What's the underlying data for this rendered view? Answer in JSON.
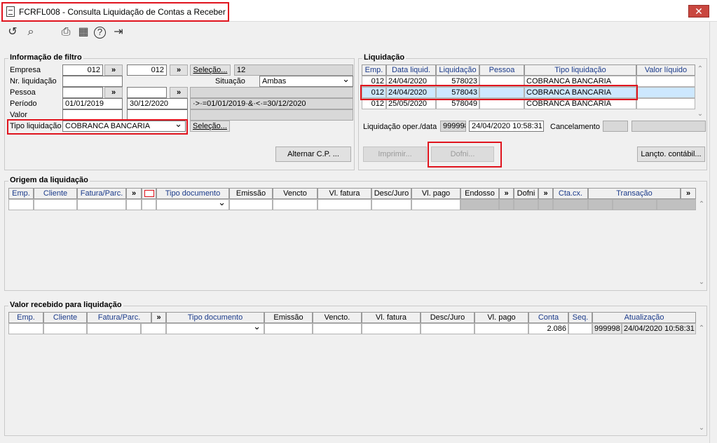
{
  "window": {
    "title": "FCRFL008 - Consulta Liquidação de Contas a Receber",
    "close_glyph": "✕"
  },
  "toolbar": [
    {
      "name": "undo-icon",
      "glyph": "↺"
    },
    {
      "name": "search-icon",
      "glyph": "⌕"
    },
    {
      "name": "print-icon",
      "glyph": "⎙"
    },
    {
      "name": "calendar-icon",
      "glyph": "▦"
    },
    {
      "name": "help-icon",
      "glyph": "?"
    },
    {
      "name": "exit-icon",
      "glyph": "⇥"
    }
  ],
  "filter": {
    "legend": "Informação de filtro",
    "empresa": {
      "label": "Empresa",
      "from": "012",
      "to": "012",
      "selecao": "Seleção...",
      "display": "12"
    },
    "nr_liquidacao": {
      "label": "Nr. liquidação"
    },
    "situacao": {
      "label": "Situação",
      "value": "Ambas"
    },
    "pessoa": {
      "label": "Pessoa"
    },
    "periodo": {
      "label": "Período",
      "from": "01/01/2019",
      "to": "30/12/2020",
      "expr": "·>·=01/01/2019·&·<·=30/12/2020"
    },
    "valor": {
      "label": "Valor"
    },
    "tipo_liquidacao": {
      "label": "Tipo liquidação",
      "value": "COBRANCA BANCARIA",
      "selecao": "Seleção..."
    },
    "range_btn": "»",
    "alternar_cp": "Alternar C.P. ..."
  },
  "liquidacao": {
    "legend": "Liquidação",
    "headers": [
      "Emp.",
      "Data liquid.",
      "Liquidação",
      "Pessoa",
      "Tipo liquidação",
      "Valor líquido"
    ],
    "rows": [
      [
        "012",
        "24/04/2020",
        "578023",
        "",
        "COBRANCA BANCARIA",
        ""
      ],
      [
        "012",
        "24/04/2020",
        "578043",
        "",
        "COBRANCA BANCARIA",
        ""
      ],
      [
        "012",
        "25/05/2020",
        "578049",
        "",
        "COBRANCA BANCARIA",
        ""
      ]
    ],
    "oper_label": "Liquidação oper./data",
    "oper_value": "999998",
    "oper_date": "24/04/2020 10:58:31",
    "cancel_label": "Cancelamento",
    "imprimir": "Imprimir...",
    "dofni": "Dofni...",
    "lancto": "Lançto. contábil..."
  },
  "origem": {
    "legend": "Origem da liquidação",
    "headers": [
      "Emp.",
      "Cliente",
      "Fatura/Parc.",
      "»",
      "",
      "Tipo documento",
      "Emissão",
      "Vencto",
      "Vl. fatura",
      "Desc/Juro",
      "Vl. pago",
      "Endosso",
      "»",
      "Dofni",
      "»",
      "Cta.cx.",
      "Transação",
      "»"
    ]
  },
  "valor_recebido": {
    "legend": "Valor recebido para liquidação",
    "headers": [
      "Emp.",
      "Cliente",
      "Fatura/Parc.",
      "»",
      "Tipo documento",
      "Emissão",
      "Vencto.",
      "Vl. fatura",
      "Desc/Juro",
      "Vl. pago",
      "Conta",
      "Seq.",
      "Atualização"
    ],
    "row": {
      "conta": "2.086",
      "atual_user": "999998",
      "atual_date": "24/04/2020 10:58:31"
    }
  }
}
